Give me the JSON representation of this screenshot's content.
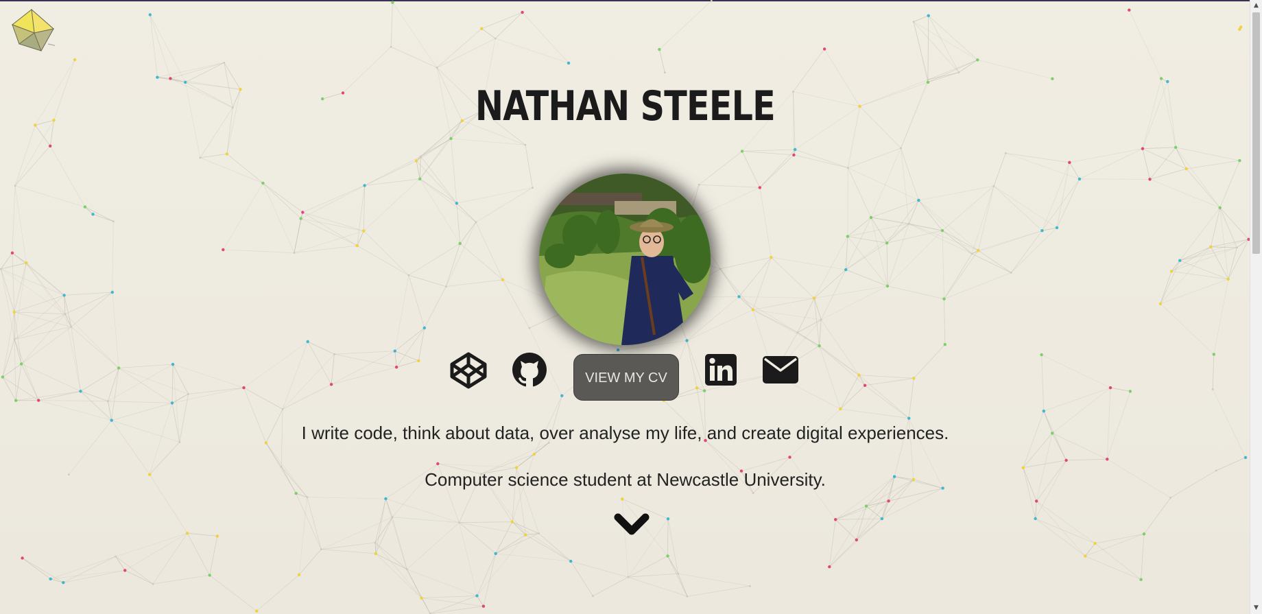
{
  "hero": {
    "name": "NATHAN STEELE",
    "cv_button_label": "VIEW MY CV",
    "tagline_1": "I write code, think about data, over analyse my life, and create digital experiences.",
    "tagline_2": "Computer science student at Newcastle University."
  },
  "social_icons": [
    "codepen-icon",
    "github-icon",
    "linkedin-icon",
    "email-icon"
  ],
  "colors": {
    "background": "#efece2",
    "text": "#1d1d1b",
    "button": "#5a5955",
    "node_cyan": "#3fb8cf",
    "node_pink": "#e0457b",
    "node_yellow": "#f2d23a",
    "node_green": "#7ccf6b",
    "link_line": "#b8b4a6",
    "logo_yellow": "#f3e36b"
  }
}
